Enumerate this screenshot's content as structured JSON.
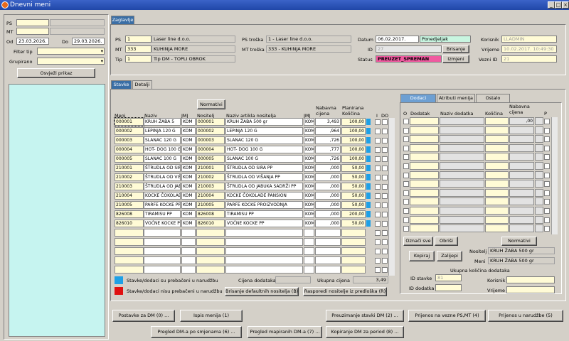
{
  "window": {
    "title": "Dnevni meni"
  },
  "left": {
    "ps_label": "PS",
    "mt_label": "MT",
    "od_label": "Od",
    "od_value": "23.03.2026.",
    "do_label": "Do",
    "do_value": "29.03.2026.",
    "filter_label": "Filter tip",
    "grupirano_label": "Grupirano",
    "refresh_label": "Osvježi prikaz"
  },
  "header_tab": "Zaglavlje",
  "header": {
    "ps_label": "PS",
    "ps_value": "1",
    "ps_name": "Laser line d.o.o.",
    "mt_label": "MT",
    "mt_value": "333",
    "mt_name": "KUHINJA  MORE",
    "tip_label": "Tip",
    "tip_value": "1",
    "tip_name": "Tip DM - TOPLI OBROK",
    "pstr_label": "PS troška",
    "pstr_value": "1 - Laser line d.o.o.",
    "mttr_label": "MT troška",
    "mttr_value": "333 - KUHINJA  MORE",
    "datum_label": "Datum",
    "datum_value": "06.02.2017.",
    "dan_value": "Ponedjeljak",
    "id_label": "ID",
    "id_value": "27",
    "brisanje_label": "Brisanje",
    "status_label": "Status",
    "status_value": "PREUZET_SPREMAN",
    "izmjeni_label": "Izmjeni",
    "korisnik_label": "Korisnik",
    "korisnik_value": "LLADMIN",
    "vrijeme_label": "Vrijeme",
    "vrijeme_value": "10.02.2017. 10:49:30",
    "vezni_label": "Vezni ID",
    "vezni_value": "21"
  },
  "tabs": [
    "Stavke",
    "Detalji"
  ],
  "grid": {
    "normativi_label": "Normativi",
    "columns": [
      "Meni",
      "Naziv",
      "JMJ",
      "Nositelj",
      "Naziv artikla nositelja",
      "JMJ",
      "Nabavna cijena",
      "Planirana Količina",
      "I",
      "DO"
    ],
    "rows": [
      {
        "meni": "000001",
        "naziv": "KRUH ŽABA 5",
        "jmj": "KOM",
        "nos": "000001",
        "naz2": "KRUH ŽABA 500 gr",
        "jmj2": "KOM",
        "cijena": "3,493",
        "kol": "100,00"
      },
      {
        "meni": "000002",
        "naziv": "LEPINJA 120 G",
        "jmj": "KOM",
        "nos": "000002",
        "naz2": "LEPINJA 120 G",
        "jmj2": "KOM",
        "cijena": ",964",
        "kol": "100,00"
      },
      {
        "meni": "000003",
        "naziv": "SLANAC 120 G",
        "jmj": "KOM",
        "nos": "000003",
        "naz2": "SLANAC 120 G",
        "jmj2": "KOM",
        "cijena": ",726",
        "kol": "100,00"
      },
      {
        "meni": "000004",
        "naziv": "HOT- DOG 100 G",
        "jmj": "KOM",
        "nos": "000004",
        "naz2": "HOT- DOG 100 G",
        "jmj2": "KOM",
        "cijena": ",777",
        "kol": "100,00"
      },
      {
        "meni": "000005",
        "naziv": "SLANAC 100 G",
        "jmj": "KOM",
        "nos": "000005",
        "naz2": "SLANAC 100 G",
        "jmj2": "KOM",
        "cijena": ",726",
        "kol": "100,00"
      },
      {
        "meni": "210001",
        "naziv": "ŠTRUDLA OD SIRA",
        "jmj": "KOM",
        "nos": "210001",
        "naz2": "ŠTRUDLA OD SIRA PP",
        "jmj2": "KOM",
        "cijena": ",000",
        "kol": "50,00"
      },
      {
        "meni": "210002",
        "naziv": "ŠTRUDLA OD VIŠNJA",
        "jmj": "KOM",
        "nos": "210002",
        "naz2": "ŠTRUDLA OD VIŠANJA PP",
        "jmj2": "KOM",
        "cijena": ",000",
        "kol": "50,00"
      },
      {
        "meni": "210003",
        "naziv": "ŠTRUDLA OD JABUKA",
        "jmj": "KOM",
        "nos": "210003",
        "naz2": "ŠTRUDLA OD JABUKA SADRŽI PP",
        "jmj2": "KOM",
        "cijena": ",000",
        "kol": "50,00"
      },
      {
        "meni": "210004",
        "naziv": "KOCKE ČOKOLADA",
        "jmj": "KOM",
        "nos": "210004",
        "naz2": "KOCKE ČOKOLADE PANSION",
        "jmj2": "KOM",
        "cijena": ",000",
        "kol": "50,00"
      },
      {
        "meni": "210005",
        "naziv": "PARFE KOCKE PROIZ",
        "jmj": "KOM",
        "nos": "210005",
        "naz2": "PARFE KOCKE PROIZVODNJA",
        "jmj2": "KOM",
        "cijena": ",000",
        "kol": "50,00"
      },
      {
        "meni": "826008",
        "naziv": "TIRAMISU PP",
        "jmj": "KOM",
        "nos": "826008",
        "naz2": "TIRAMISU PP",
        "jmj2": "KOM",
        "cijena": ",000",
        "kol": "200,00"
      },
      {
        "meni": "826010",
        "naziv": "VOĆNE KOCKE PP",
        "jmj": "KOM",
        "nos": "826010",
        "naz2": "VOĆNE KOCKE PP",
        "jmj2": "KOM",
        "cijena": ",000",
        "kol": "50,00"
      }
    ],
    "legend_blue": "Stavke/dodaci su prebačeni u narudžbu",
    "legend_red": "Stavke/dodaci nisu prebačeni u narudžbu",
    "cijena_dodataka_label": "Cijena dodataka",
    "ukupna_cijena_label": "Ukupna  cijena",
    "ukupna_cijena_value": "3,49",
    "brisanje_nositelja": "Brisanje defaultnih nositelja (B)",
    "rasporedi_nositelje": "Rasporedi nositelje iz predloška (R)"
  },
  "right": {
    "tabs": [
      "Dodaci",
      "Atributi menija",
      "Ostalo"
    ],
    "columns": [
      "O",
      "Dodatak",
      "Naziv dodatka",
      "Količina",
      "Nabavna cijena",
      "P"
    ],
    "first_cijena": ",00",
    "oznaci_label": "Označi sve",
    "obrisi_label": "Obriši",
    "normativi_label": "Normativi",
    "kopiraj_label": "Kopiraj",
    "zalijepi_label": "Zalijepi",
    "nositelj_label": "Nositelj",
    "nositelj_value": "KRUH ŽABA 500 gr",
    "meni_label": "Meni",
    "meni_value": "KRUH ŽABA 500 gr",
    "ukupna_kolicina_label": "Ukupna količina dodataka",
    "id_stavke_label": "ID stavke",
    "id_stavke_value": "81",
    "id_dodatka_label": "ID dodatka",
    "korisnik_label": "Korisnik",
    "vrijeme_label": "Vrijeme"
  },
  "bottom": {
    "b1": "Postavke za DM (0) ...",
    "b2": "Ispis menija (1)",
    "b3": "Preuzimanje stavki DM (2) ...",
    "b4": "Prijenos na vezne PS,MT (4)",
    "b5": "Prijenos u narudžbe (5)",
    "b6": "Pregled DM-a po smjenama (6) ...",
    "b7": "Pregled mapiranih DM-a (7) ...",
    "b8": "Kopiranje DM za period (8) ..."
  },
  "colors": {
    "accent": "#3a6ea5",
    "status": "#f05aa0",
    "legend_blue": "#1ea0e6",
    "legend_red": "#e01010",
    "field": "#fffbd6"
  }
}
